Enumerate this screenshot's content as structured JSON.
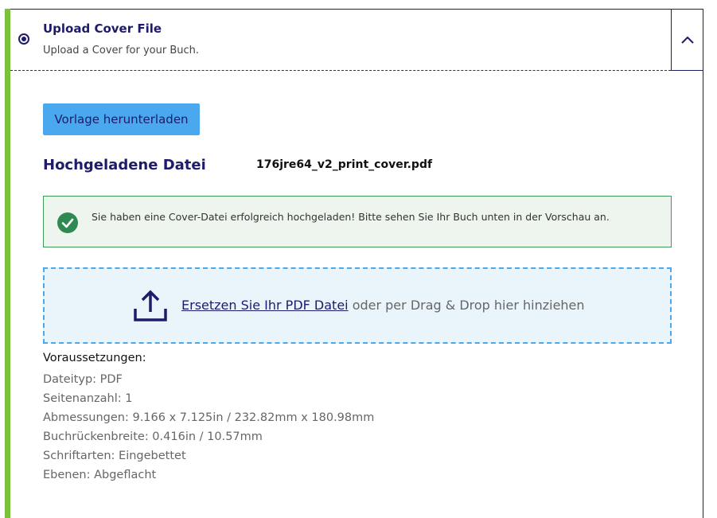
{
  "header": {
    "title": "Upload Cover File",
    "subtitle": "Upload a Cover for your Buch."
  },
  "actions": {
    "download_template_label": "Vorlage herunterladen"
  },
  "uploaded": {
    "label": "Hochgeladene Datei",
    "filename": "176jre64_v2_print_cover.pdf"
  },
  "success": {
    "message": "Sie haben eine Cover-Datei erfolgreich hochgeladen! Bitte sehen Sie Ihr Buch unten in der Vorschau an."
  },
  "dropzone": {
    "link_text": "Ersetzen Sie Ihr PDF Datei",
    "rest_text": " oder per Drag & Drop hier hinziehen"
  },
  "requirements": {
    "title": "Voraussetzungen:",
    "items": [
      "Dateityp: PDF",
      "Seitenanzahl: 1",
      "Abmessungen: 9.166 x 7.125in / 232.82mm x 180.98mm",
      "Buchrückenbreite: 0.416in / 10.57mm",
      "Schriftarten: Eingebettet",
      "Ebenen: Abgeflacht"
    ]
  },
  "colors": {
    "brand_navy": "#1e1b6b",
    "accent_green": "#7cc13a",
    "button_blue": "#4aa8ee",
    "success_green": "#3f9a57"
  },
  "icons": {
    "collapse": "chevron-up-icon",
    "success": "check-circle-icon",
    "upload": "upload-icon"
  }
}
